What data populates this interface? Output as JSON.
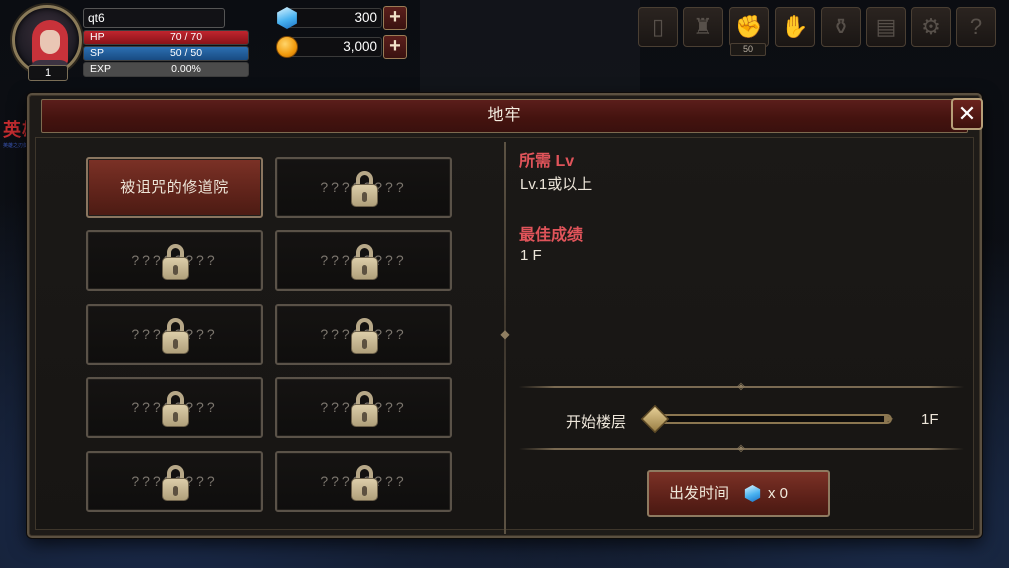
{
  "player": {
    "name": "qt6",
    "level": "1",
    "hp_label": "HP",
    "hp_value": "70 / 70",
    "hp_fraction": 1.0,
    "sp_label": "SP",
    "sp_value": "50 / 50",
    "sp_fraction": 1.0,
    "exp_label": "EXP",
    "exp_value": "0.00%",
    "exp_fraction": 0.0
  },
  "currency": {
    "gems": "300",
    "gold": "3,000",
    "add_label": "+"
  },
  "top_menu": {
    "icons": [
      "door-icon",
      "helmet-icon",
      "skill-icon",
      "fist-icon",
      "potion-bag-icon",
      "book-icon",
      "gear-icon",
      "help-icon"
    ],
    "glyphs": [
      "▯",
      "♜",
      "✊",
      "✋",
      "⚱",
      "▤",
      "⚙",
      "?"
    ],
    "skill_badge": "50"
  },
  "side_logo": {
    "text": "英雄",
    "sub": "英雄之刃剑"
  },
  "dialog": {
    "title": "地牢",
    "close_label": "✕",
    "dungeons": [
      {
        "label": "被诅咒的修道院",
        "locked": false
      },
      {
        "label": "????????",
        "locked": true
      },
      {
        "label": "????????",
        "locked": true
      },
      {
        "label": "????????",
        "locked": true
      },
      {
        "label": "????????",
        "locked": true
      },
      {
        "label": "????????",
        "locked": true
      },
      {
        "label": "????????",
        "locked": true
      },
      {
        "label": "????????",
        "locked": true
      },
      {
        "label": "????????",
        "locked": true
      },
      {
        "label": "????????",
        "locked": true
      }
    ],
    "required_lv_heading": "所需 Lv",
    "required_lv_value": "Lv.1或以上",
    "best_record_heading": "最佳成绩",
    "best_record_value": "1 F",
    "start_floor_label": "开始楼层",
    "start_floor_value": "1F",
    "start_floor_fraction": 0.0,
    "depart_label": "出发时间",
    "depart_cost": "x 0"
  },
  "colors": {
    "accent_red": "#e0545a",
    "button_red": "#5f231a",
    "frame_gold": "#8b7650"
  }
}
